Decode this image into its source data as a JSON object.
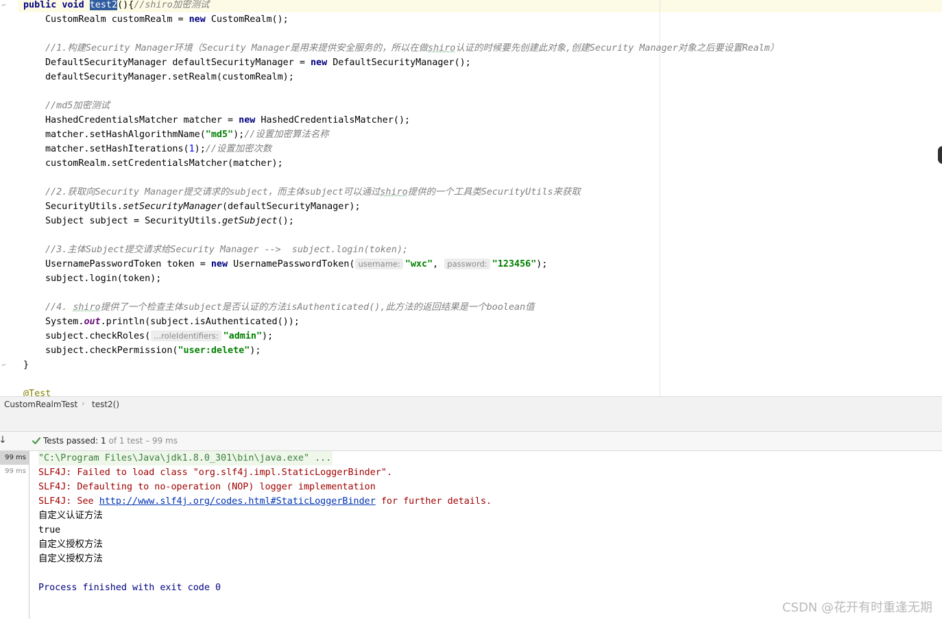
{
  "editor": {
    "lines": {
      "l0": {
        "kw": "public void ",
        "method": "test2",
        "rest": "(){",
        "comment": "//shiro加密测试"
      },
      "l1": {
        "text": "CustomRealm customRealm = ",
        "kw": "new",
        "rest": " CustomRealm();"
      },
      "l3": {
        "comment_a": "//1.构建Security Manager环境（Security Manager是用来提供安全服务的，所以在做",
        "comment_b": "shiro",
        "comment_c": "认证的时候要先创建此对象,创建Security Manager对象之后要设置Realm）"
      },
      "l4": {
        "text": "DefaultSecurityManager defaultSecurityManager = ",
        "kw": "new",
        "rest": " DefaultSecurityManager();"
      },
      "l5": {
        "text": "defaultSecurityManager.setRealm(customRealm);"
      },
      "l7": {
        "comment": "//md5加密测试"
      },
      "l8": {
        "text": "HashedCredentialsMatcher matcher = ",
        "kw": "new",
        "rest": " HashedCredentialsMatcher();"
      },
      "l9": {
        "text": "matcher.setHashAlgorithmName(",
        "str": "\"md5\"",
        "rest": ");",
        "comment": "//设置加密算法名称"
      },
      "l10": {
        "text": "matcher.setHashIterations(",
        "num": "1",
        "rest": ");",
        "comment": "//设置加密次数"
      },
      "l11": {
        "text": "customRealm.setCredentialsMatcher(matcher);"
      },
      "l13": {
        "comment_a": "//2.获取向Security Manager提交请求的subject，而主体subject可以通过",
        "comment_b": "shiro",
        "comment_c": "提供的一个工具类SecurityUtils来获取"
      },
      "l14": {
        "text": "SecurityUtils.",
        "it": "setSecurityManager",
        "rest": "(defaultSecurityManager);"
      },
      "l15": {
        "text": "Subject subject = SecurityUtils.",
        "it": "getSubject",
        "rest": "();"
      },
      "l17": {
        "comment": "//3.主体Subject提交请求给Security Manager -->  subject.login(token);"
      },
      "l18": {
        "text": "UsernamePasswordToken token = ",
        "kw": "new",
        "text2": " UsernamePasswordToken(",
        "hint1": "username:",
        "str1": "\"wxc\"",
        "comma": ", ",
        "hint2": "password:",
        "str2": "\"123456\"",
        "rest": ");"
      },
      "l19": {
        "text": "subject.login(token);"
      },
      "l21": {
        "comment_a": "//4. ",
        "comment_b": "shiro",
        "comment_c": "提供了一个检查主体subject是否认证的方法isAuthenticated(),此方法的返回结果是一个boolean值"
      },
      "l22": {
        "text": "System.",
        "static": "out",
        "rest": ".println(subject.isAuthenticated());"
      },
      "l23": {
        "text": "subject.checkRoles(",
        "hint": "...roleIdentifiers:",
        "str": "\"admin\"",
        "rest": ");"
      },
      "l24": {
        "text": "subject.checkPermission(",
        "str": "\"user:delete\"",
        "rest": ");"
      },
      "l25": {
        "text": "}"
      },
      "l27": {
        "ann": "@Test"
      }
    }
  },
  "breadcrumb": {
    "class_name": "CustomRealmTest",
    "method": "test2()"
  },
  "run": {
    "status_label": "Tests passed:",
    "passed": "1",
    "detail": "of 1 test – 99 ms",
    "tree": [
      "99 ms",
      "99 ms"
    ]
  },
  "console": {
    "cmd": "\"C:\\Program Files\\Java\\jdk1.8.0_301\\bin\\java.exe\" ...",
    "err1": "SLF4J: Failed to load class \"org.slf4j.impl.StaticLoggerBinder\".",
    "err2": "SLF4J: Defaulting to no-operation (NOP) logger implementation",
    "err3_a": "SLF4J: See ",
    "err3_link": "http://www.slf4j.org/codes.html#StaticLoggerBinder",
    "err3_b": " for further details.",
    "out1": "自定义认证方法",
    "out2": "true",
    "out3": "自定义授权方法",
    "out4": "自定义授权方法",
    "exit": "Process finished with exit code 0"
  },
  "watermark": "CSDN @花开有时重逢无期"
}
